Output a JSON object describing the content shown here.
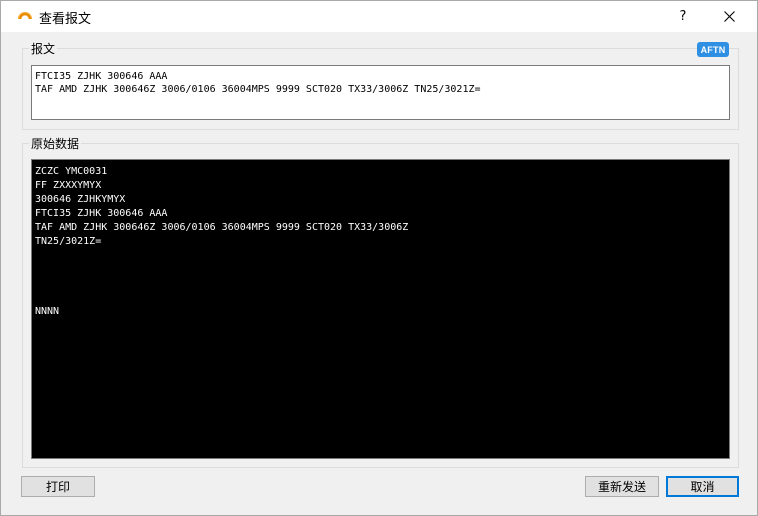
{
  "window": {
    "title": "查看报文",
    "help_label": "?"
  },
  "message_group": {
    "label": "报文",
    "badge": "AFTN",
    "text": "FTCI35 ZJHK 300646 AAA\nTAF AMD ZJHK 300646Z 3006/0106 36004MPS 9999 SCT020 TX33/3006Z TN25/3021Z="
  },
  "raw_group": {
    "label": "原始数据",
    "text": "ZCZC YMC0031\nFF ZXXXYMYX\n300646 ZJHKYMYX\nFTCI35 ZJHK 300646 AAA\nTAF AMD ZJHK 300646Z 3006/0106 36004MPS 9999 SCT020 TX33/3006Z\nTN25/3021Z=\n\n\n\n\nNNNN"
  },
  "buttons": {
    "print": "打印",
    "resend": "重新发送",
    "cancel": "取消"
  },
  "colors": {
    "badge": "#2f8fe3",
    "default_button_border": "#0078d7",
    "raw_background": "#000000",
    "raw_text": "#ffffff"
  }
}
